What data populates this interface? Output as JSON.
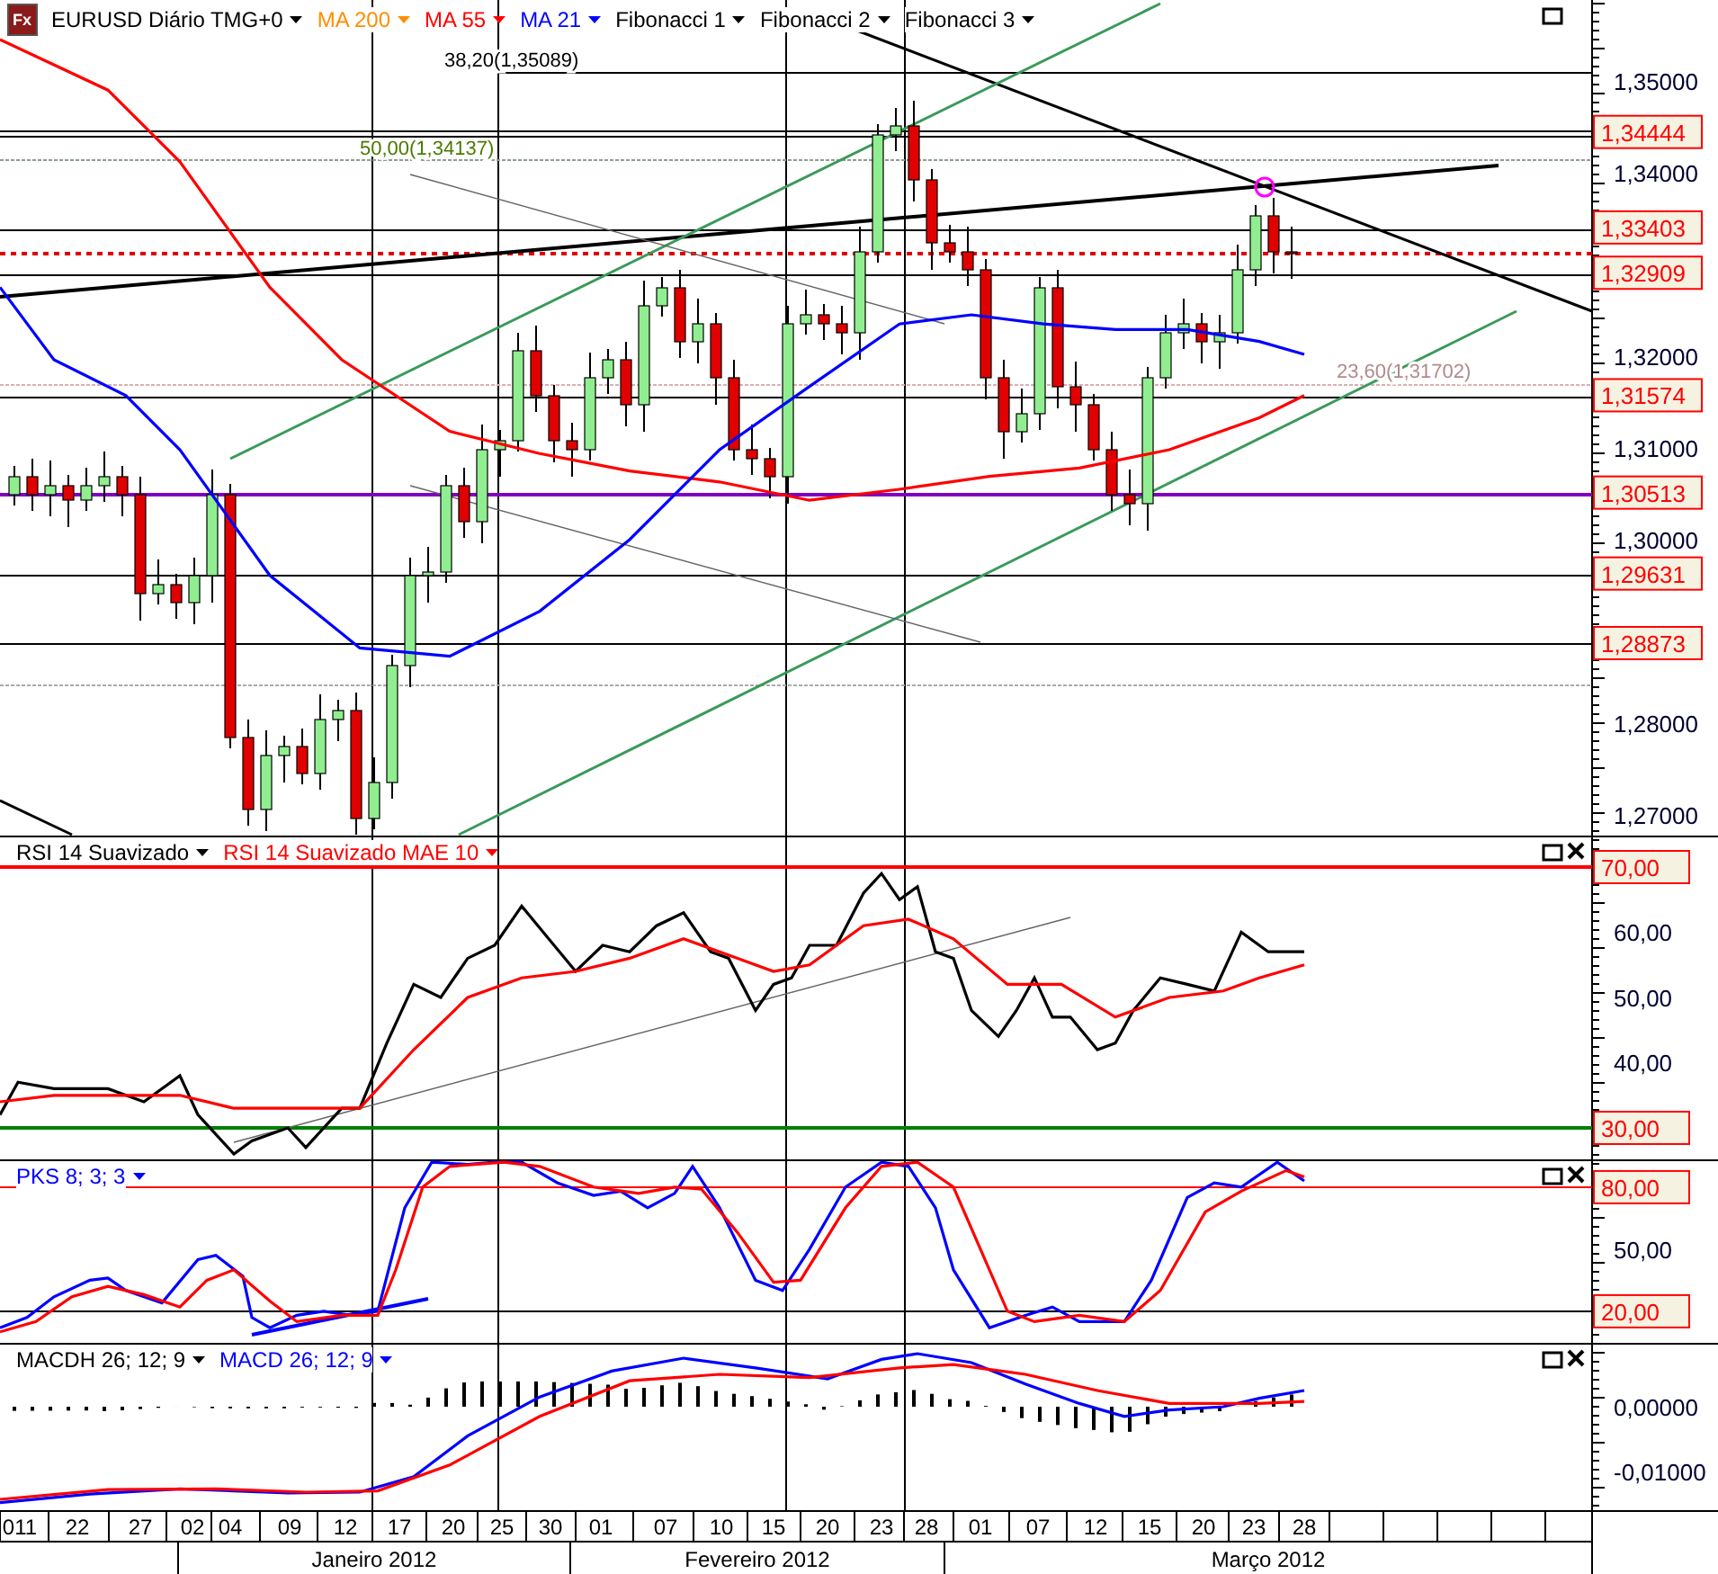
{
  "panels": [
    {
      "logo": "Fx",
      "closable": false,
      "legend": [
        {
          "label": "EURUSD Diário TMG+0",
          "color": "#000000"
        },
        {
          "label": "MA 200",
          "color": "#ff8c00"
        },
        {
          "label": "MA 55",
          "color": "#ff0000"
        },
        {
          "label": "MA 21",
          "color": "#0000ff"
        },
        {
          "label": "Fibonacci 1",
          "color": "#000000"
        },
        {
          "label": "Fibonacci 2",
          "color": "#000000"
        },
        {
          "label": "Fibonacci 3",
          "color": "#000000"
        }
      ],
      "axis_labels": [
        "1,35000",
        "1,34000",
        "1,32000",
        "1,31000",
        "1,30000",
        "1,28000",
        "1,27000"
      ],
      "price_tags": [
        "1,34444",
        "1,33403",
        "1,32909",
        "1,31574",
        "1,30513",
        "1,29631",
        "1,28873"
      ],
      "fib_labels": [
        {
          "label": "38,20(1,35089)",
          "color": "#000000"
        },
        {
          "label": "50,00(1,34137)",
          "color": "#4a7a00"
        },
        {
          "label": "23,60(1,31702)",
          "color": "#b08a8a"
        }
      ]
    },
    {
      "closable": true,
      "legend": [
        {
          "label": "RSI 14 Suavizado",
          "color": "#000000"
        },
        {
          "label": "RSI 14 Suavizado MAE 10",
          "color": "#ff0000"
        }
      ],
      "axis_labels": [
        "60,00",
        "50,00",
        "40,00"
      ],
      "price_tags": [
        "70,00",
        "30,00"
      ]
    },
    {
      "closable": true,
      "legend": [
        {
          "label": "PKS 8; 3; 3",
          "color": "#0000ff"
        }
      ],
      "axis_labels": [
        "50,00"
      ],
      "price_tags": [
        "80,00",
        "20,00"
      ]
    },
    {
      "closable": true,
      "legend": [
        {
          "label": "MACDH 26; 12; 9",
          "color": "#000000"
        },
        {
          "label": "MACD 26; 12; 9",
          "color": "#0000ff"
        }
      ],
      "axis_labels": [
        "0,00000",
        "-0,01000"
      ]
    }
  ],
  "date_axis": {
    "days": [
      "011",
      "22",
      "27",
      "02",
      "04",
      "09",
      "12",
      "17",
      "20",
      "25",
      "30",
      "01",
      "07",
      "10",
      "15",
      "20",
      "23",
      "28",
      "01",
      "07",
      "12",
      "15",
      "20",
      "23",
      "28"
    ],
    "months": [
      "Janeiro 2012",
      "Fevereiro 2012",
      "Março 2012"
    ]
  }
}
